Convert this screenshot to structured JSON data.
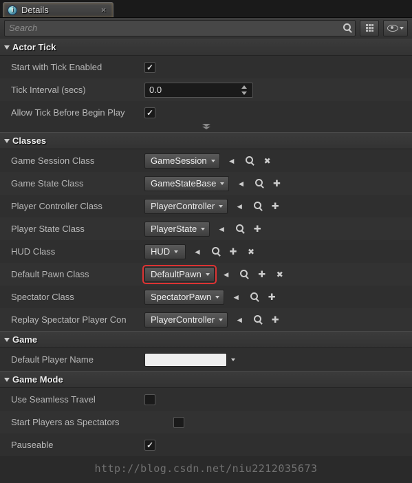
{
  "tab": {
    "title": "Details"
  },
  "toolbar": {
    "search_placeholder": "Search"
  },
  "sections": {
    "actor_tick": {
      "title": "Actor Tick",
      "start_with_tick_label": "Start with Tick Enabled",
      "start_with_tick": true,
      "tick_interval_label": "Tick Interval (secs)",
      "tick_interval": "0.0",
      "allow_before_begin_label": "Allow Tick Before Begin Play",
      "allow_before_begin": true
    },
    "classes": {
      "title": "Classes",
      "game_session_label": "Game Session Class",
      "game_session": "GameSession",
      "game_state_label": "Game State Class",
      "game_state": "GameStateBase",
      "player_controller_label": "Player Controller Class",
      "player_controller": "PlayerController",
      "player_state_label": "Player State Class",
      "player_state": "PlayerState",
      "hud_label": "HUD Class",
      "hud": "HUD",
      "default_pawn_label": "Default Pawn Class",
      "default_pawn": "DefaultPawn",
      "spectator_label": "Spectator Class",
      "spectator": "SpectatorPawn",
      "replay_spectator_label": "Replay Spectator Player Con",
      "replay_spectator": "PlayerController"
    },
    "game": {
      "title": "Game",
      "default_player_name_label": "Default Player Name",
      "default_player_name": ""
    },
    "game_mode": {
      "title": "Game Mode",
      "seamless_label": "Use Seamless Travel",
      "seamless": false,
      "start_spectators_label": "Start Players as Spectators",
      "start_spectators": false,
      "pauseable_label": "Pauseable",
      "pauseable": true
    }
  },
  "watermark": "http://blog.csdn.net/niu2212035673"
}
